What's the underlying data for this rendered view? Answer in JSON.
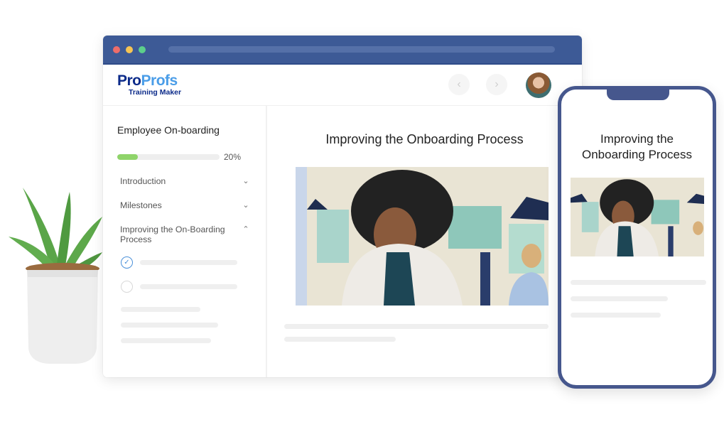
{
  "browser": {
    "window_controls": [
      "close",
      "minimize",
      "maximize"
    ],
    "colors": {
      "titlebar": "#3d5a96",
      "accent_green": "#8fd46a",
      "check_blue": "#4a90d9"
    }
  },
  "header": {
    "logo": {
      "pro": "Pro",
      "profs": "Profs",
      "subtitle": "Training Maker"
    },
    "nav": {
      "prev_icon": "‹",
      "next_icon": "›"
    },
    "avatar_alt": "user-avatar"
  },
  "sidebar": {
    "course_title": "Employee On-boarding",
    "progress": {
      "percent": 20,
      "label": "20%"
    },
    "sections": [
      {
        "label": "Introduction",
        "expanded": false,
        "chevron": "⌄"
      },
      {
        "label": "Milestones",
        "expanded": false,
        "chevron": "⌄"
      },
      {
        "label": "Improving the On-Boarding Process",
        "expanded": true,
        "chevron": "⌃"
      }
    ],
    "lessons": [
      {
        "completed": true,
        "check_icon": "✓"
      },
      {
        "completed": false
      }
    ]
  },
  "main": {
    "lesson_title": "Improving the Onboarding Process"
  },
  "phone": {
    "lesson_title": "Improving the Onboarding Process"
  }
}
